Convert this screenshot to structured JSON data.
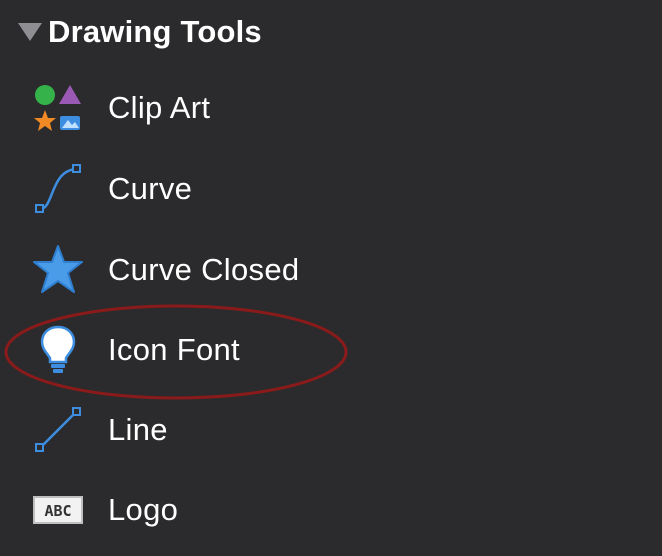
{
  "section": {
    "title": "Drawing Tools",
    "expanded": true,
    "icon": "disclosure-triangle-down-icon"
  },
  "items": [
    {
      "label": "Clip Art",
      "icon": "clip-art-shapes-icon"
    },
    {
      "label": "Curve",
      "icon": "curve-icon"
    },
    {
      "label": "Curve Closed",
      "icon": "star-shape-icon"
    },
    {
      "label": "Icon Font",
      "icon": "lightbulb-icon"
    },
    {
      "label": "Line",
      "icon": "line-icon"
    },
    {
      "label": "Logo",
      "icon": "abc-text-box-icon"
    }
  ],
  "colors": {
    "background": "#2b2b2d",
    "text": "#ffffff",
    "accent_blue": "#3d8ee0",
    "highlight_ring": "#8b1a1a"
  }
}
